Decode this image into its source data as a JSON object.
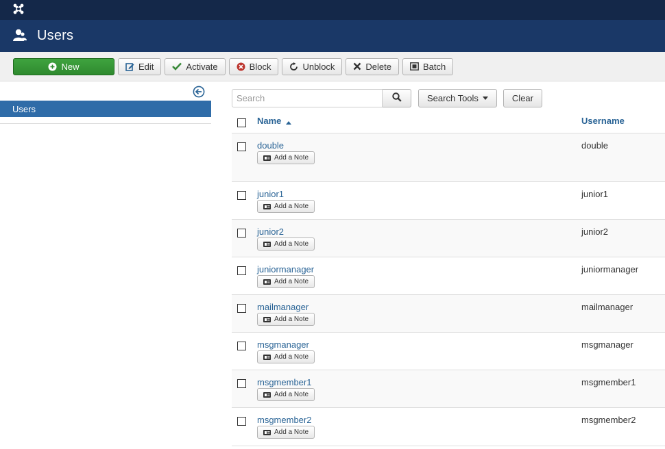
{
  "app": {
    "logo_icon": "joomla-logo-icon"
  },
  "header": {
    "title": "Users",
    "icon": "users-icon"
  },
  "toolbar": {
    "new": "New",
    "edit": "Edit",
    "activate": "Activate",
    "block": "Block",
    "unblock": "Unblock",
    "delete": "Delete",
    "batch": "Batch"
  },
  "sidebar": {
    "items": [
      {
        "label": "Users"
      }
    ]
  },
  "filter": {
    "search_placeholder": "Search",
    "search_value": "",
    "tools_label": "Search Tools",
    "clear_label": "Clear"
  },
  "table": {
    "columns": {
      "name": "Name",
      "username": "Username"
    },
    "note_label": "Add a Note",
    "rows": [
      {
        "name": "double",
        "username": "double"
      },
      {
        "name": "junior1",
        "username": "junior1"
      },
      {
        "name": "junior2",
        "username": "junior2"
      },
      {
        "name": "juniormanager",
        "username": "juniormanager"
      },
      {
        "name": "mailmanager",
        "username": "mailmanager"
      },
      {
        "name": "msgmanager",
        "username": "msgmanager"
      },
      {
        "name": "msgmember1",
        "username": "msgmember1"
      },
      {
        "name": "msgmember2",
        "username": "msgmember2"
      }
    ]
  },
  "colors": {
    "topbar": "#142849",
    "header": "#1a3867",
    "accent": "#2f6ca8",
    "new_button": "#3a9a3a"
  }
}
